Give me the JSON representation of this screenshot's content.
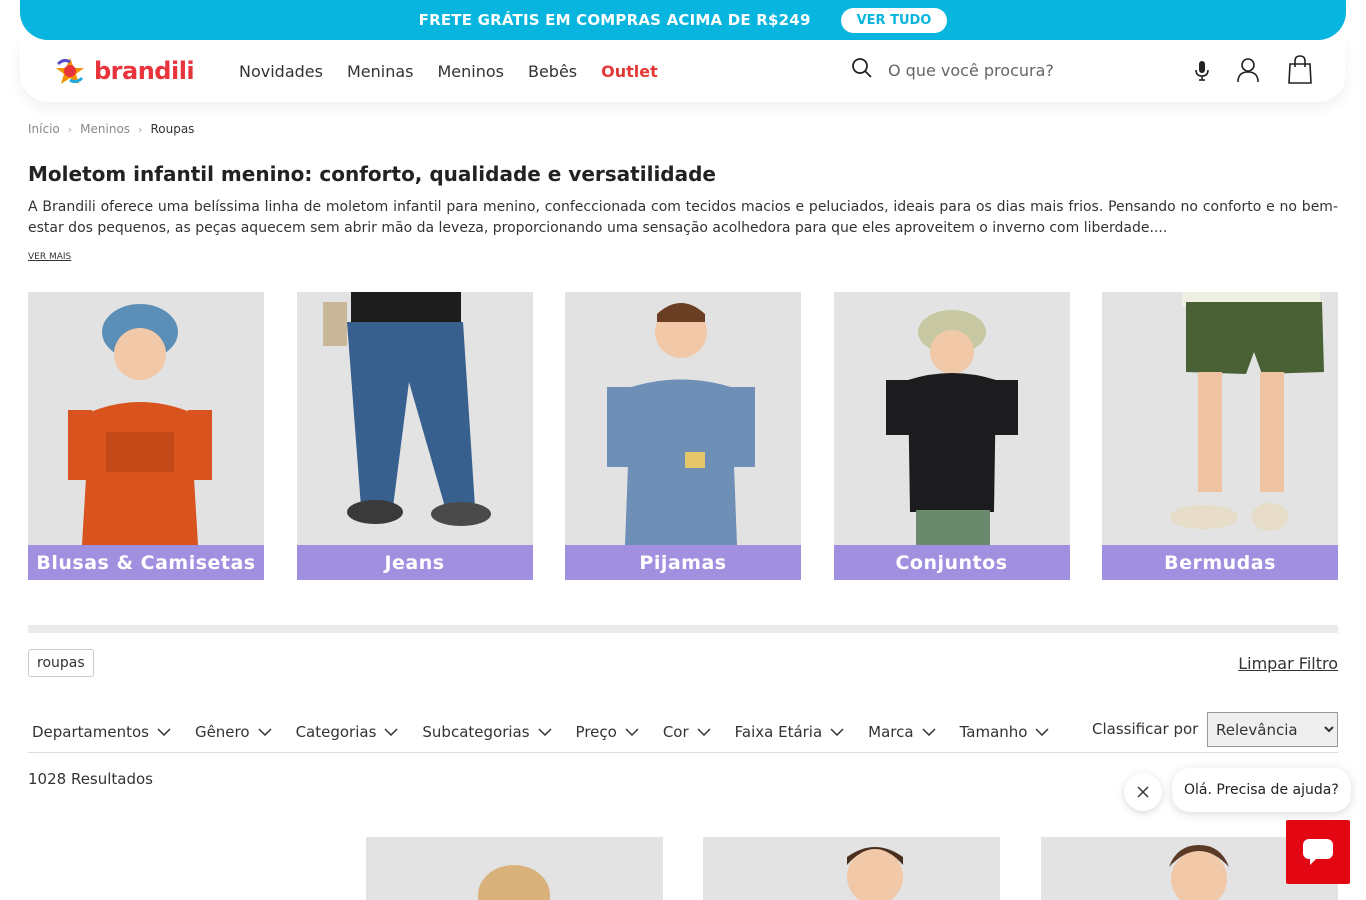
{
  "promo": {
    "text": "FRETE GRÁTIS EM COMPRAS ACIMA DE R$249",
    "button": "VER TUDO"
  },
  "header": {
    "logo_text": "brandili",
    "nav": [
      "Novidades",
      "Meninas",
      "Meninos",
      "Bebês",
      "Outlet"
    ],
    "search_placeholder": "O que você procura?",
    "icons": [
      "search-icon",
      "microphone-icon",
      "user-icon",
      "shopping-bag-icon"
    ]
  },
  "breadcrumb": [
    "Início",
    "Meninos",
    "Roupas"
  ],
  "intro": {
    "title": "Moletom infantil menino: conforto, qualidade e versatilidade",
    "description": "A Brandili oferece uma belíssima linha de moletom infantil para menino, confeccionada com tecidos macios e peluciados, ideais para os dias mais frios. Pensando no conforto e no bem-estar dos pequenos, as peças aquecem sem abrir mão da leveza, proporcionando uma sensação acolhedora para que eles aproveitem o inverno com liberdade....",
    "more_link": "VER MAIS"
  },
  "categories": [
    "Blusas & Camisetas",
    "Jeans",
    "Pijamas",
    "Conjuntos",
    "Bermudas"
  ],
  "filters": {
    "active_tag": "roupas",
    "clear_label": "Limpar Filtro",
    "items": [
      "Departamentos",
      "Gênero",
      "Categorias",
      "Subcategorias",
      "Preço",
      "Cor",
      "Faixa Etária",
      "Marca",
      "Tamanho"
    ],
    "sort_label": "Classificar por",
    "sort_value": "Relevância"
  },
  "results": {
    "count_text": "1028 Resultados"
  },
  "chat": {
    "greeting": "Olá. Precisa de ajuda?"
  },
  "colors": {
    "accent": "#08b5de",
    "brand_red": "#e8343a",
    "category_band": "#a18fe0",
    "chat_red": "#e30613"
  }
}
